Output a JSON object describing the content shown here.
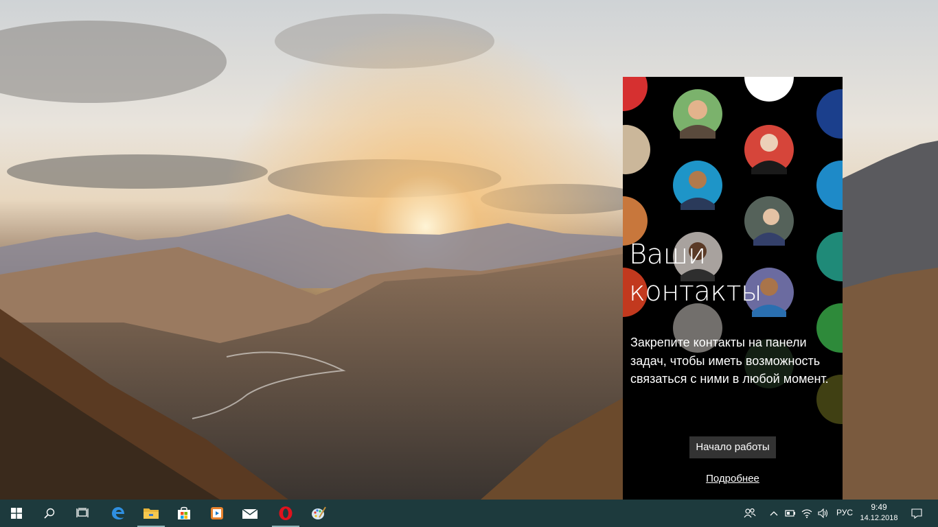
{
  "people_panel": {
    "title_line1": "Ваши",
    "title_line2": "контакты",
    "description": "Закрепите контакты на панели задач, чтобы иметь возможность связаться с ними в любой момент.",
    "start_button_label": "Начало работы",
    "more_link_label": "Подробнее"
  },
  "taskbar": {
    "buttons": [
      {
        "name": "start-button",
        "icon": "windows-logo-icon"
      },
      {
        "name": "search-button",
        "icon": "search-icon"
      },
      {
        "name": "task-view-button",
        "icon": "task-view-icon"
      },
      {
        "name": "edge-button",
        "icon": "edge-icon"
      },
      {
        "name": "file-explorer-button",
        "icon": "folder-icon"
      },
      {
        "name": "store-button",
        "icon": "store-icon"
      },
      {
        "name": "media-player-button",
        "icon": "media-player-icon"
      },
      {
        "name": "mail-button",
        "icon": "mail-icon"
      },
      {
        "name": "opera-button",
        "icon": "opera-icon"
      },
      {
        "name": "paint-button",
        "icon": "paint-icon"
      }
    ],
    "tray": {
      "language": "РУС",
      "time": "9:49",
      "date": "14.12.2018"
    },
    "colors": {
      "background": "#1d3a3d",
      "accent": "#8fb4b8"
    }
  }
}
